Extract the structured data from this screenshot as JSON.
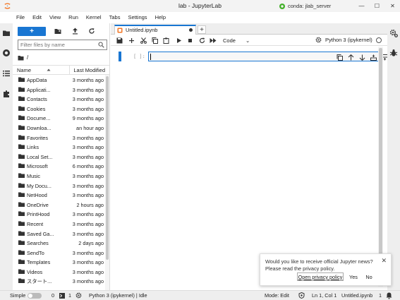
{
  "window": {
    "title": "lab - JupyterLab",
    "conda_label": "conda: jlab_server",
    "minimize": "—",
    "maximize": "☐",
    "close": "✕"
  },
  "menu": {
    "items": [
      "File",
      "Edit",
      "View",
      "Run",
      "Kernel",
      "Tabs",
      "Settings",
      "Help"
    ]
  },
  "filebrowser": {
    "new_label": "+",
    "search_placeholder": "Filter files by name",
    "breadcrumb": "/",
    "col_name": "Name",
    "col_modified": "Last Modified",
    "rows": [
      {
        "name": "AppData",
        "modified": "3 months ago"
      },
      {
        "name": "Applicati...",
        "modified": "3 months ago"
      },
      {
        "name": "Contacts",
        "modified": "3 months ago"
      },
      {
        "name": "Cookies",
        "modified": "3 months ago"
      },
      {
        "name": "Docume...",
        "modified": "9 months ago"
      },
      {
        "name": "Downloa...",
        "modified": "an hour ago"
      },
      {
        "name": "Favorites",
        "modified": "3 months ago"
      },
      {
        "name": "Links",
        "modified": "3 months ago"
      },
      {
        "name": "Local Set...",
        "modified": "3 months ago"
      },
      {
        "name": "Microsoft",
        "modified": "6 months ago"
      },
      {
        "name": "Music",
        "modified": "3 months ago"
      },
      {
        "name": "My Docu...",
        "modified": "3 months ago"
      },
      {
        "name": "NetHood",
        "modified": "3 months ago"
      },
      {
        "name": "OneDrive",
        "modified": "2 hours ago"
      },
      {
        "name": "PrintHood",
        "modified": "3 months ago"
      },
      {
        "name": "Recent",
        "modified": "3 months ago"
      },
      {
        "name": "Saved Ga...",
        "modified": "3 months ago"
      },
      {
        "name": "Searches",
        "modified": "2 days ago"
      },
      {
        "name": "SendTo",
        "modified": "3 months ago"
      },
      {
        "name": "Templates",
        "modified": "3 months ago"
      },
      {
        "name": "Videos",
        "modified": "3 months ago"
      },
      {
        "name": "スタート...",
        "modified": "3 months ago"
      },
      {
        "name": "",
        "modified": ""
      }
    ]
  },
  "notebook": {
    "tab_label": "Untitled.ipynb",
    "tab_add": "+",
    "cell_type": "Code",
    "cell_type_caret": "⌄",
    "kernel_label": "Python 3 (ipykernel)",
    "cell_prompt": "[ ]:"
  },
  "notification": {
    "message": "Would you like to receive official Jupyter news? Please read the privacy policy.",
    "link_label": "Open privacy policy",
    "yes_label": "Yes",
    "no_label": "No",
    "close": "✕"
  },
  "status": {
    "mode_label": "Simple",
    "terminals": "0",
    "kernels": "1",
    "kernel_status": "Python 3 (ipykernel) | Idle",
    "mode": "Mode: Edit",
    "position": "Ln 1, Col 1",
    "filename": "Untitled.ipynb",
    "notifications": "1"
  },
  "colors": {
    "accent": "#1976d2",
    "jupyter_orange": "#f37726"
  }
}
